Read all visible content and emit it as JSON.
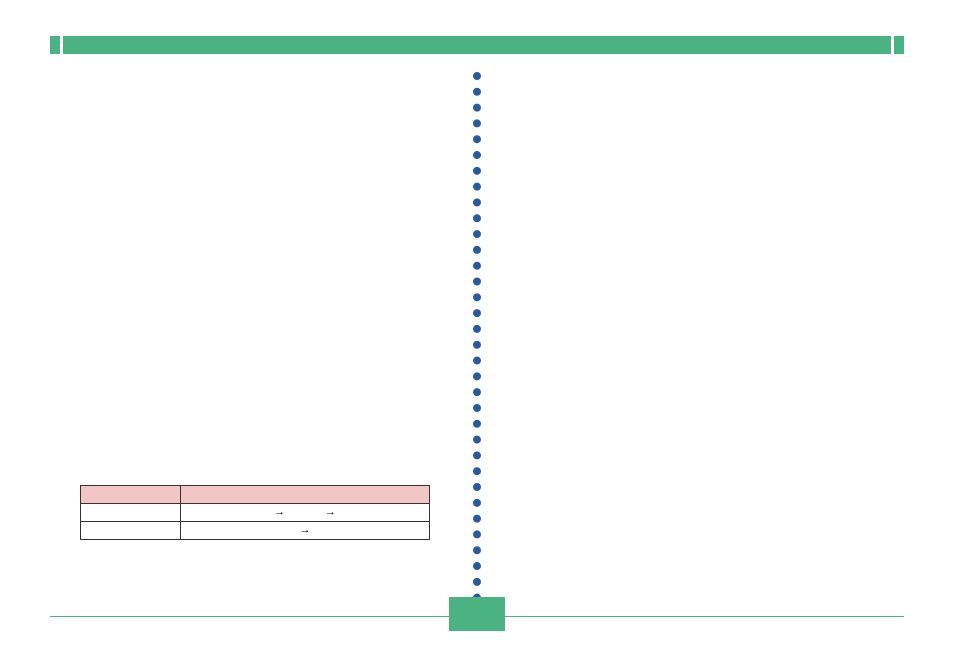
{
  "colors": {
    "accent": "#4bb381",
    "dots": "#2a5a9e",
    "table_header_bg": "#f3c6c6"
  },
  "table": {
    "header": {
      "col1": "",
      "col2": ""
    },
    "rows": [
      {
        "col1": "",
        "arrows": [
          "→",
          "→"
        ]
      },
      {
        "col1": "",
        "arrows": [
          "→"
        ]
      }
    ]
  },
  "page_number": ""
}
